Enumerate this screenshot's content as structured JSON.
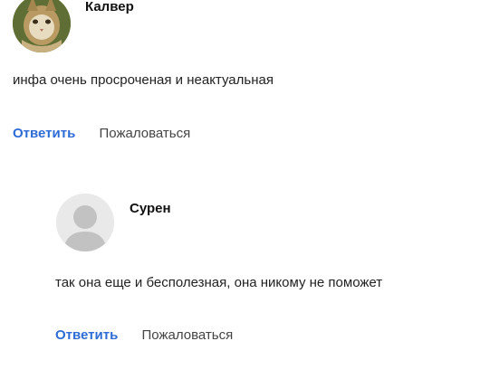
{
  "comments": [
    {
      "author": "Калвер",
      "avatar_icon": "cat-photo-avatar",
      "text": "инфа очень просроченая и неактуальная",
      "reply_label": "Ответить",
      "report_label": "Пожаловаться"
    },
    {
      "author": "Сурен",
      "avatar_icon": "default-user-avatar-icon",
      "text": "так она еще и бесполезная, она никому не поможет",
      "reply_label": "Ответить",
      "report_label": "Пожаловаться"
    }
  ],
  "colors": {
    "link": "#2d6bd6",
    "default_avatar_bg": "#e9e9e9",
    "default_avatar_fg": "#c2c2c2"
  }
}
